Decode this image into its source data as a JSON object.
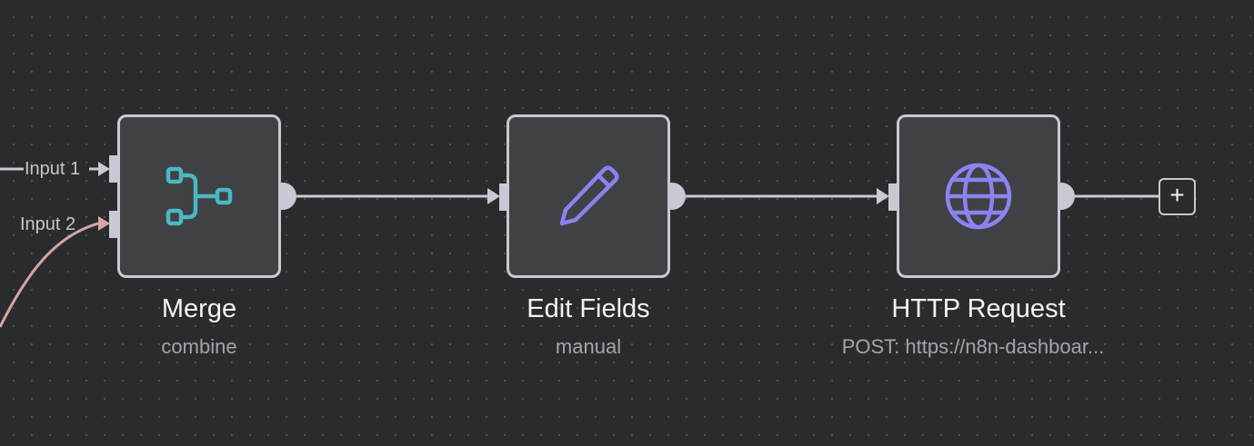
{
  "workflow": {
    "colors": {
      "canvas_bg": "#2a2b2c",
      "node_border": "#c7cad3",
      "node_fill": "#404144",
      "merge_icon": "#4ab8c5",
      "edit_icon": "#8b83f0",
      "http_icon": "#8b83f0",
      "connection": "#c7cad3",
      "input2_connection": "#d8a4a8"
    },
    "nodes": [
      {
        "title": "Merge",
        "subtitle": "combine",
        "icon": "merge-icon"
      },
      {
        "title": "Edit Fields",
        "subtitle": "manual",
        "icon": "pencil-icon"
      },
      {
        "title": "HTTP Request",
        "subtitle": "POST: https://n8n-dashboar...",
        "icon": "globe-icon"
      }
    ],
    "merge_inputs": [
      "Input 1",
      "Input 2"
    ],
    "add_button": "+"
  }
}
